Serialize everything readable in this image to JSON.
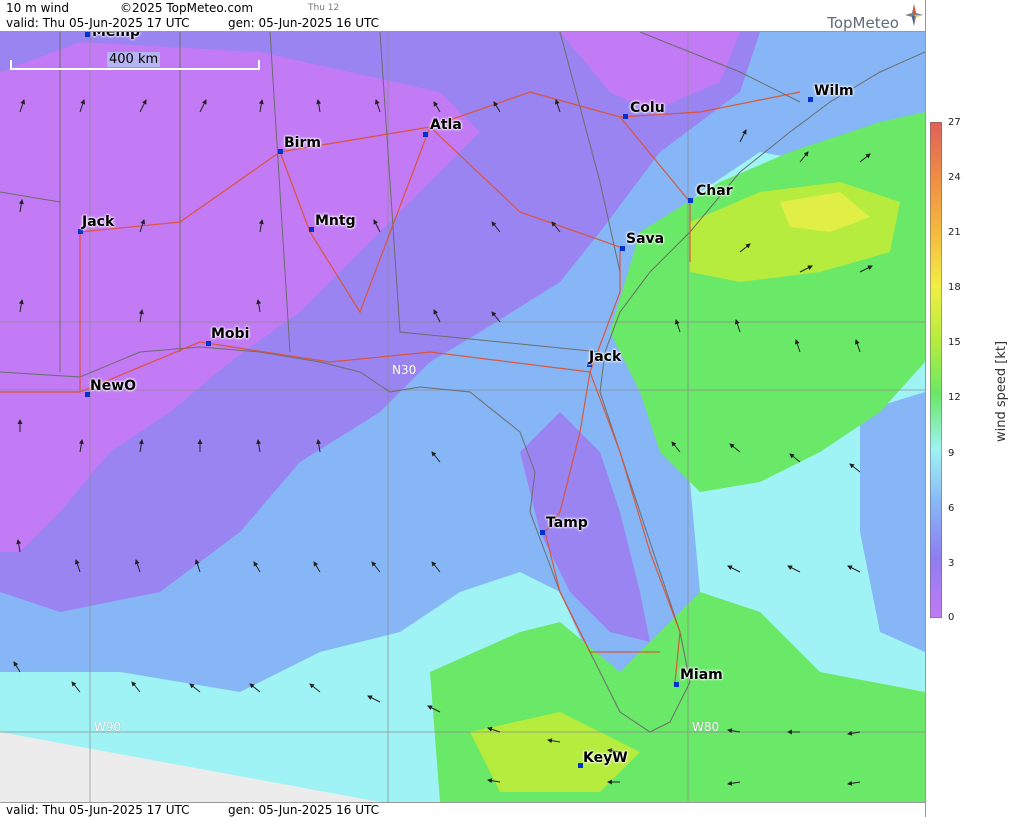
{
  "header": {
    "product": "10 m wind",
    "copyright": "©2025 TopMeteo.com",
    "tab": "Thu 12",
    "valid": "valid:  Thu  05-Jun-2025  17 UTC",
    "gen": "gen: 05-Jun-2025 16 UTC",
    "logo": "TopMeteo"
  },
  "footer": {
    "valid": "valid:  Thu  05-Jun-2025  17 UTC",
    "gen": "gen: 05-Jun-2025 16 UTC"
  },
  "scale_bar": {
    "label": "400 km"
  },
  "grid_labels": {
    "lat": "N30",
    "lon_west": "W90",
    "lon_east": "W80"
  },
  "cities": [
    {
      "name": "Memp"
    },
    {
      "name": "Atla"
    },
    {
      "name": "Colu"
    },
    {
      "name": "Wilm"
    },
    {
      "name": "Birm"
    },
    {
      "name": "Char"
    },
    {
      "name": "Jack"
    },
    {
      "name": "Mntg"
    },
    {
      "name": "Sava"
    },
    {
      "name": "Mobi"
    },
    {
      "name": "Jack"
    },
    {
      "name": "NewO"
    },
    {
      "name": "Tamp"
    },
    {
      "name": "Miam"
    },
    {
      "name": "KeyW"
    }
  ],
  "legend": {
    "title": "wind speed [kt]",
    "ticks": [
      "27",
      "24",
      "21",
      "18",
      "15",
      "12",
      "9",
      "6",
      "3",
      "0"
    ],
    "colors": [
      "#e0605a",
      "#ef8c45",
      "#f5b840",
      "#f2ee45",
      "#b6ec3e",
      "#6ae868",
      "#a0f3f4",
      "#87b6f6",
      "#8e7ef2",
      "#c27af5"
    ]
  },
  "colors": {
    "calm": "#c27af5",
    "light": "#9a84f2",
    "moderate": "#87b6f6",
    "breeze": "#a0f3f4",
    "fresh": "#6ae868",
    "strong": "#b6ec3e",
    "road": "#e0502a",
    "border": "#707070"
  }
}
